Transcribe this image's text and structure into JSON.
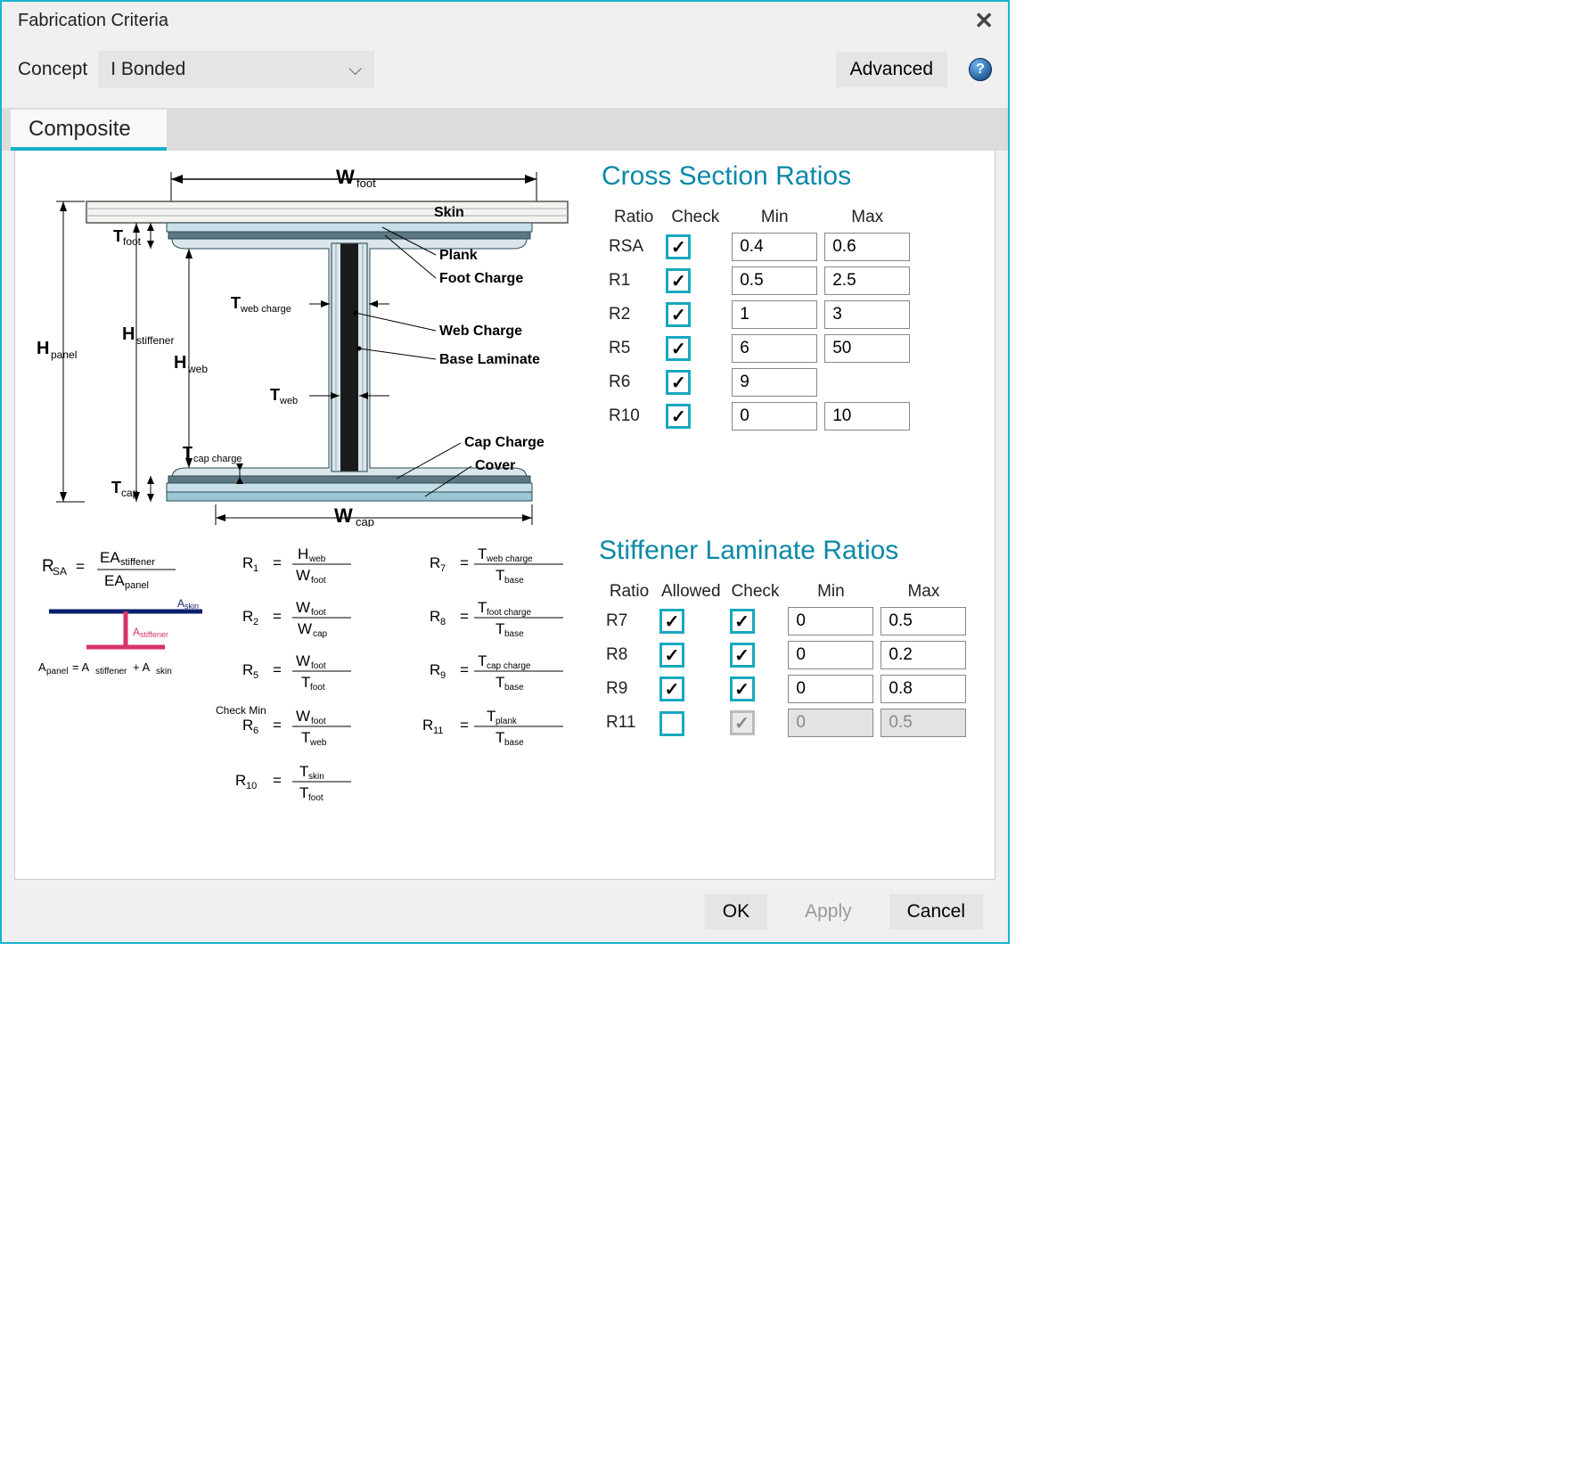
{
  "window": {
    "title": "Fabrication Criteria"
  },
  "concept": {
    "label": "Concept",
    "value": "I Bonded"
  },
  "buttons": {
    "advanced": "Advanced",
    "ok": "OK",
    "apply": "Apply",
    "cancel": "Cancel"
  },
  "tabs": {
    "composite": "Composite"
  },
  "diagram": {
    "labels": {
      "wfoot": "W",
      "wfoot_sub": "foot",
      "skin": "Skin",
      "plank": "Plank",
      "foot_charge": "Foot Charge",
      "tfoot": "T",
      "tfoot_sub": "foot",
      "hpanel": "H",
      "hpanel_sub": "panel",
      "hstiff": "H",
      "hstiff_sub": "stiffener",
      "hweb": "H",
      "hweb_sub": "web",
      "tweb_charge": "T",
      "tweb_charge_sub": "web charge",
      "web_charge": "Web Charge",
      "base_lam": "Base Laminate",
      "tweb": "T",
      "tweb_sub": "web",
      "tcap_charge": "T",
      "tcap_charge_sub": "cap charge",
      "cap_charge": "Cap Charge",
      "cover": "Cover",
      "tcap": "T",
      "tcap_sub": "cap",
      "wcap": "W",
      "wcap_sub": "cap"
    }
  },
  "cross_section": {
    "title": "Cross Section Ratios",
    "headers": {
      "ratio": "Ratio",
      "check": "Check",
      "min": "Min",
      "max": "Max"
    },
    "rows": [
      {
        "name": "RSA",
        "checked": true,
        "min": "0.4",
        "max": "0.6"
      },
      {
        "name": "R1",
        "checked": true,
        "min": "0.5",
        "max": "2.5"
      },
      {
        "name": "R2",
        "checked": true,
        "min": "1",
        "max": "3"
      },
      {
        "name": "R5",
        "checked": true,
        "min": "6",
        "max": "50"
      },
      {
        "name": "R6",
        "checked": true,
        "min": "9",
        "max": ""
      },
      {
        "name": "R10",
        "checked": true,
        "min": "0",
        "max": "10"
      }
    ]
  },
  "formula_labels": {
    "rsa": "R",
    "rsa_sub": "SA",
    "ea_stiff": "EA",
    "ea_stiff_sub": "stiffener",
    "ea_panel": "EA",
    "ea_panel_sub": "panel",
    "askin": "A",
    "askin_sub": "skin",
    "astiff": "A",
    "astiff_sub": "stiffener",
    "apanel_eq": "A",
    "apanel_eq_text": "panel = Astiffener + Askin",
    "r1": "R",
    "hweb": "H",
    "hweb_sub": "web",
    "wfoot": "W",
    "wfoot_sub": "foot",
    "r2": "R",
    "wcap": "W",
    "wcap_sub": "cap",
    "r5": "R",
    "tfoot": "T",
    "tfoot_sub": "foot",
    "r6": "R",
    "check_min": "Check Min",
    "tweb": "T",
    "tweb_sub": "web",
    "r10": "R",
    "tskin": "T",
    "tskin_sub": "skin",
    "r7": "R",
    "tweb_charge": "T",
    "tweb_charge_sub": "web charge",
    "tbase": "T",
    "tbase_sub": "base",
    "r8": "R",
    "tfoot_charge": "T",
    "tfoot_charge_sub": "foot charge",
    "r9": "R",
    "tcap_charge": "T",
    "tcap_charge_sub": "cap charge",
    "r11": "R",
    "tplank": "T",
    "tplank_sub": "plank"
  },
  "laminate": {
    "title": "Stiffener Laminate Ratios",
    "headers": {
      "ratio": "Ratio",
      "allowed": "Allowed",
      "check": "Check",
      "min": "Min",
      "max": "Max"
    },
    "rows": [
      {
        "name": "R7",
        "allowed": true,
        "checked": true,
        "enabled": true,
        "min": "0",
        "max": "0.5"
      },
      {
        "name": "R8",
        "allowed": true,
        "checked": true,
        "enabled": true,
        "min": "0",
        "max": "0.2"
      },
      {
        "name": "R9",
        "allowed": true,
        "checked": true,
        "enabled": true,
        "min": "0",
        "max": "0.8"
      },
      {
        "name": "R11",
        "allowed": false,
        "checked": true,
        "enabled": false,
        "min": "0",
        "max": "0.5"
      }
    ]
  }
}
